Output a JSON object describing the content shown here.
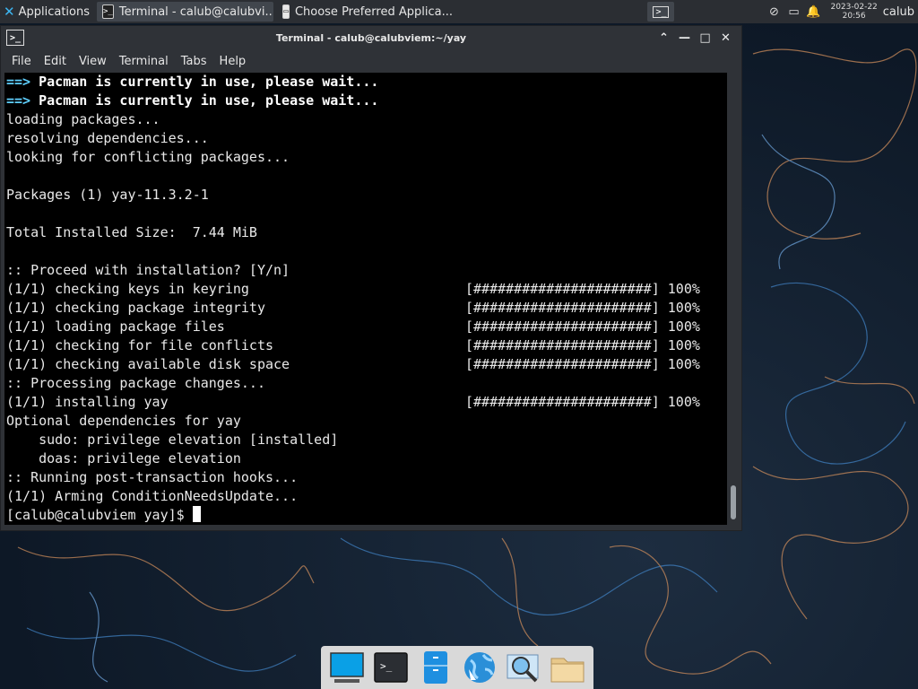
{
  "panel": {
    "apps_label": "Applications",
    "tasks": [
      {
        "label": "Terminal - calub@calubvi...",
        "icon": "terminal-icon"
      },
      {
        "label": "Choose Preferred Applica...",
        "icon": "settings-window-icon"
      }
    ],
    "clock_date": "2023-02-22",
    "clock_time": "20:56",
    "user": "calub"
  },
  "window": {
    "title": "Terminal - calub@calubviem:~/yay",
    "menu": [
      "File",
      "Edit",
      "View",
      "Terminal",
      "Tabs",
      "Help"
    ]
  },
  "terminal": {
    "lines": [
      {
        "prefix": "==>",
        "text": " Pacman is currently in use, please wait...",
        "bold": true
      },
      {
        "prefix": "==>",
        "text": " Pacman is currently in use, please wait...",
        "bold": true
      },
      {
        "text": "loading packages..."
      },
      {
        "text": "resolving dependencies..."
      },
      {
        "text": "looking for conflicting packages..."
      },
      {
        "text": ""
      },
      {
        "text": "Packages (1) yay-11.3.2-1"
      },
      {
        "text": ""
      },
      {
        "text": "Total Installed Size:  7.44 MiB"
      },
      {
        "text": ""
      },
      {
        "text": ":: Proceed with installation? [Y/n]"
      },
      {
        "text": "(1/1) checking keys in keyring",
        "progress": "[######################] 100%"
      },
      {
        "text": "(1/1) checking package integrity",
        "progress": "[######################] 100%"
      },
      {
        "text": "(1/1) loading package files",
        "progress": "[######################] 100%"
      },
      {
        "text": "(1/1) checking for file conflicts",
        "progress": "[######################] 100%"
      },
      {
        "text": "(1/1) checking available disk space",
        "progress": "[######################] 100%"
      },
      {
        "text": ":: Processing package changes..."
      },
      {
        "text": "(1/1) installing yay",
        "progress": "[######################] 100%"
      },
      {
        "text": "Optional dependencies for yay"
      },
      {
        "text": "    sudo: privilege elevation [installed]"
      },
      {
        "text": "    doas: privilege elevation"
      },
      {
        "text": ":: Running post-transaction hooks..."
      },
      {
        "text": "(1/1) Arming ConditionNeedsUpdate..."
      }
    ],
    "prompt": "[calub@calubviem yay]$ "
  },
  "dock": [
    {
      "name": "show-desktop",
      "icon": "desktop-icon"
    },
    {
      "name": "terminal",
      "icon": "terminal-icon"
    },
    {
      "name": "file-manager-tray",
      "icon": "cabinet-icon"
    },
    {
      "name": "web-browser",
      "icon": "globe-icon"
    },
    {
      "name": "app-finder",
      "icon": "magnifier-icon"
    },
    {
      "name": "files",
      "icon": "folder-icon"
    }
  ]
}
